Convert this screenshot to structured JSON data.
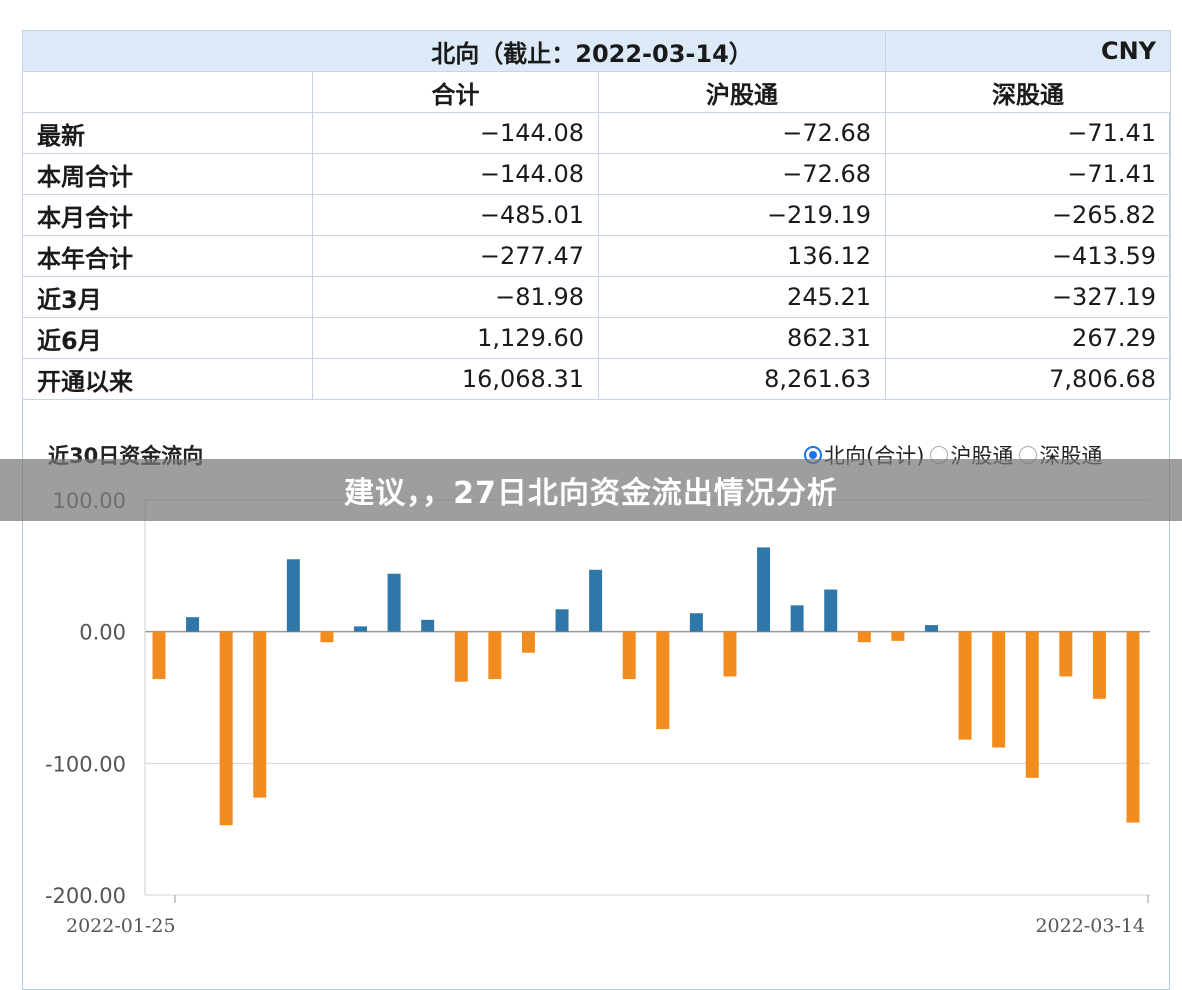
{
  "table": {
    "title": "北向（截止：2022-03-14）",
    "currency": "CNY",
    "columns": [
      "合计",
      "沪股通",
      "深股通"
    ],
    "rows": [
      {
        "label": "最新",
        "values": [
          "−144.08",
          "−72.68",
          "−71.41"
        ]
      },
      {
        "label": "本周合计",
        "values": [
          "−144.08",
          "−72.68",
          "−71.41"
        ]
      },
      {
        "label": "本月合计",
        "values": [
          "−485.01",
          "−219.19",
          "−265.82"
        ]
      },
      {
        "label": "本年合计",
        "values": [
          "−277.47",
          "136.12",
          "−413.59"
        ]
      },
      {
        "label": "近3月",
        "values": [
          "−81.98",
          "245.21",
          "−327.19"
        ]
      },
      {
        "label": "近6月",
        "values": [
          "1,129.60",
          "862.31",
          "267.29"
        ]
      },
      {
        "label": "开通以来",
        "values": [
          "16,068.31",
          "8,261.63",
          "7,806.68"
        ]
      }
    ]
  },
  "chart_section": {
    "title": "近30日资金流向",
    "legend": [
      {
        "label": "北向(合计)",
        "selected": true
      },
      {
        "label": "沪股通",
        "selected": false
      },
      {
        "label": "深股通",
        "selected": false
      }
    ]
  },
  "overlay": {
    "text": "建议，，27日北向资金流出情况分析"
  },
  "colors": {
    "positive": "#2e77a8",
    "negative": "#f28c1e",
    "header_bg": "#dce9f7"
  },
  "chart_data": {
    "type": "bar",
    "title": "近30日资金流向",
    "ylim": [
      -200,
      100
    ],
    "yticks": [
      "100.00",
      "0.00",
      "-100.00",
      "-200.00"
    ],
    "ytick_values": [
      100,
      0,
      -100,
      -200
    ],
    "x_labels": [
      "2022-01-25",
      "2022-03-14"
    ],
    "values": [
      -36,
      11,
      -147,
      -126,
      55,
      -8,
      4,
      44,
      9,
      -38,
      -36,
      -16,
      17,
      47,
      -36,
      -74,
      14,
      -34,
      64,
      20,
      32,
      -8,
      -7,
      5,
      -82,
      -88,
      -111,
      -34,
      -51,
      -145
    ]
  }
}
